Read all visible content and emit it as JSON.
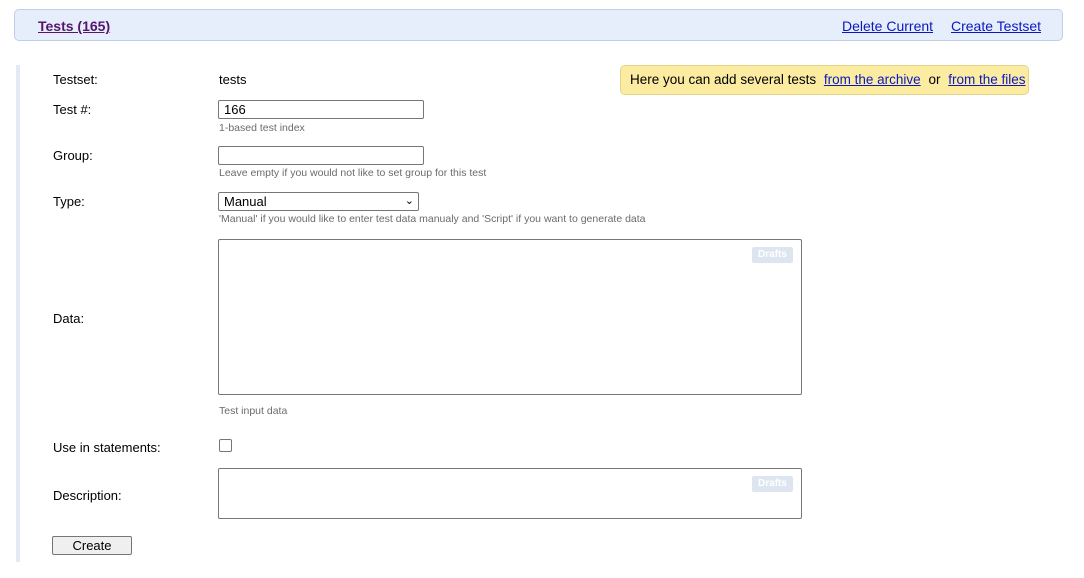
{
  "header": {
    "title": "Tests (165)",
    "delete_label": "Delete Current",
    "create_testset_label": "Create Testset"
  },
  "notice": {
    "text_before": "Here you can add several tests",
    "archive_link": "from the archive",
    "or": "or",
    "files_link": "from the files"
  },
  "form": {
    "testset": {
      "label": "Testset:",
      "value": "tests"
    },
    "test_number": {
      "label": "Test #:",
      "value": "166",
      "hint": "1-based test index"
    },
    "group": {
      "label": "Group:",
      "value": "",
      "hint": "Leave empty if you would not like to set group for this test"
    },
    "type": {
      "label": "Type:",
      "selected": "Manual",
      "hint": "'Manual' if you would like to enter test data manualy and 'Script' if you want to generate data"
    },
    "data": {
      "label": "Data:",
      "drafts_label": "Drafts",
      "hint": "Test input data"
    },
    "use_in_statements": {
      "label": "Use in statements:",
      "checked": false
    },
    "description": {
      "label": "Description:",
      "drafts_label": "Drafts"
    },
    "submit_label": "Create"
  },
  "colors": {
    "link": "#0b18bf",
    "title": "#55166c",
    "header_bg": "#e6eefb",
    "notice_bg": "#fbeca2"
  }
}
